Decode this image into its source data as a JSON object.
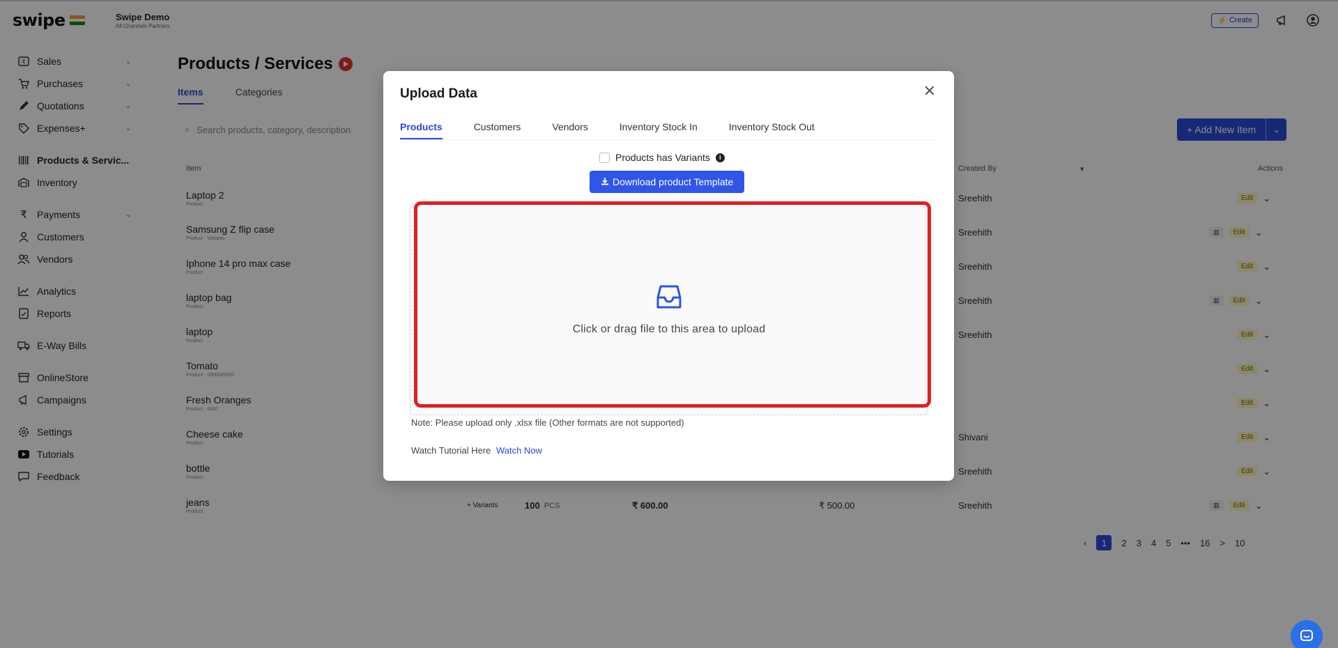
{
  "topbar": {
    "logo": "swipe",
    "company_name": "Swipe Demo",
    "company_sub": "All Channels Partners",
    "create_label": "Create",
    "flag_colors": [
      "#ff9933",
      "#ffffff",
      "#138808"
    ]
  },
  "sidebar": {
    "groups": [
      [
        {
          "label": "Sales",
          "icon": "invoice-icon",
          "chevron": true
        },
        {
          "label": "Purchases",
          "icon": "cart-icon",
          "chevron": true
        },
        {
          "label": "Quotations",
          "icon": "pen-icon",
          "chevron": true
        },
        {
          "label": "Expenses+",
          "icon": "tag-icon",
          "chevron": true
        }
      ],
      [
        {
          "label": "Products & Servic...",
          "icon": "barcode-icon",
          "chevron": false,
          "active": true
        },
        {
          "label": "Inventory",
          "icon": "warehouse-icon",
          "chevron": false
        }
      ],
      [
        {
          "label": "Payments",
          "icon": "rupee-icon",
          "chevron": true
        },
        {
          "label": "Customers",
          "icon": "user-icon",
          "chevron": false
        },
        {
          "label": "Vendors",
          "icon": "users-icon",
          "chevron": false
        }
      ],
      [
        {
          "label": "Analytics",
          "icon": "chart-icon",
          "chevron": false
        },
        {
          "label": "Reports",
          "icon": "report-icon",
          "chevron": false
        }
      ],
      [
        {
          "label": "E-Way Bills",
          "icon": "truck-icon",
          "chevron": false
        }
      ],
      [
        {
          "label": "OnlineStore",
          "icon": "store-icon",
          "chevron": false
        },
        {
          "label": "Campaigns",
          "icon": "megaphone-icon",
          "chevron": false
        }
      ],
      [
        {
          "label": "Settings",
          "icon": "gear-icon",
          "chevron": false
        },
        {
          "label": "Tutorials",
          "icon": "youtube-icon",
          "chevron": false
        },
        {
          "label": "Feedback",
          "icon": "comment-icon",
          "chevron": false
        }
      ]
    ]
  },
  "main": {
    "title": "Products / Services",
    "tabs": [
      "Items",
      "Categories"
    ],
    "search_placeholder": "Search products, category, description",
    "add_button": "+ Add New Item",
    "columns": {
      "item": "Item",
      "created_by": "Created By",
      "actions": "Actions"
    },
    "rows": [
      {
        "name": "Laptop 2",
        "sub": "Product",
        "created_by": "Sreehith",
        "extra": false
      },
      {
        "name": "Samsung Z flip case",
        "sub": "Product · Variants",
        "created_by": "Sreehith",
        "extra": true
      },
      {
        "name": "Iphone 14 pro max case",
        "sub": "Product",
        "created_by": "Sreehith",
        "extra": false
      },
      {
        "name": "laptop bag",
        "sub": "Product",
        "created_by": "Sreehith",
        "extra": true
      },
      {
        "name": "laptop",
        "sub": "Product",
        "created_by": "Sreehith",
        "extra": false
      },
      {
        "name": "Tomato",
        "sub": "Product · 0000000000",
        "created_by": "",
        "extra": false
      },
      {
        "name": "Fresh Oranges",
        "sub": "Product · 0000",
        "created_by": "",
        "extra": false
      },
      {
        "name": "Cheese cake",
        "sub": "Product",
        "created_by": "Shivani",
        "extra": false
      },
      {
        "name": "bottle",
        "sub": "Product",
        "created_by": "Sreehith",
        "extra": false
      },
      {
        "name": "jeans",
        "sub": "Product",
        "created_by": "Sreehith",
        "extra": true
      }
    ],
    "jeans_variants": "+ Variants",
    "jeans_qty": "100",
    "jeans_unit": "PCS",
    "jeans_price": "₹ 600.00",
    "jeans_purchase": "₹ 500.00",
    "edit_label": "Edit",
    "pagination": [
      "1",
      "2",
      "3",
      "4",
      "5",
      "•••",
      "16",
      ">",
      "10"
    ]
  },
  "modal": {
    "title": "Upload Data",
    "tabs": [
      "Products",
      "Customers",
      "Vendors",
      "Inventory Stock In",
      "Inventory Stock Out"
    ],
    "variants_label": "Products has Variants",
    "download_label": "Download product Template",
    "drop_text": "Click or drag file to this area to upload",
    "note": "Note: Please upload only .xlsx file (Other formats are not supported)",
    "tutorial_label": "Watch Tutorial Here",
    "tutorial_link": "Watch Now"
  }
}
